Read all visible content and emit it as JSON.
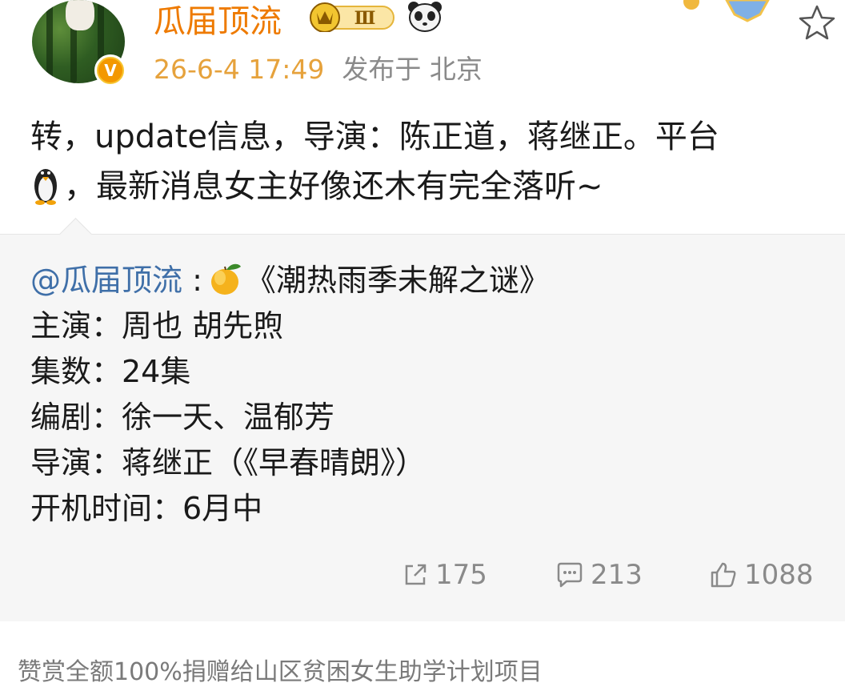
{
  "post": {
    "author": "瓜届顶流",
    "rank_badge_text": "Ⅲ",
    "timestamp": "26-6-4 17:49",
    "location": "发布于 北京",
    "text_line1": "转，update信息，导演：陈正道，蒋继正。平台",
    "text_line2": "，最新消息女主好像还木有完全落听~"
  },
  "repost": {
    "mention": "@瓜届顶流",
    "colon": " :",
    "title": "《潮热雨季未解之谜》",
    "lines": [
      "主演：周也 胡先煦",
      "集数：24集",
      "编剧：徐一天、温郁芳",
      "导演：蒋继正（《早春晴朗》）",
      "开机时间：6月中"
    ]
  },
  "actions": {
    "share_count": "175",
    "comment_count": "213",
    "like_count": "1088"
  },
  "footer": {
    "note": "赞赏全额100%捐赠给山区贫困女生助学计划项目"
  },
  "icons": {
    "star": "star-icon",
    "share": "share-icon",
    "comment": "comment-icon",
    "like": "thumbs-up-icon"
  },
  "colors": {
    "author": "#ee7a00",
    "timestamp": "#e6a23c",
    "mention": "#3f6fa8",
    "repost_bg": "#f6f6f6"
  }
}
